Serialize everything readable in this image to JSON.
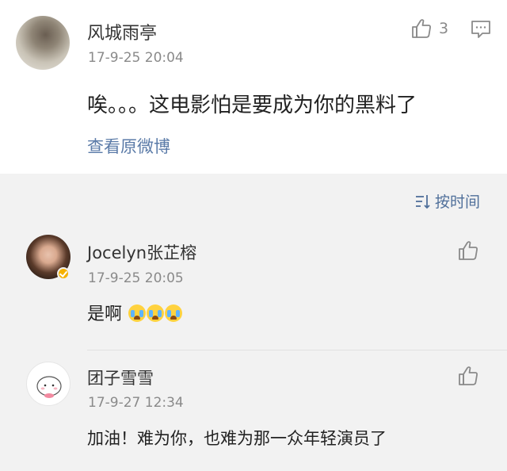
{
  "post": {
    "author": "风城雨亭",
    "time": "17-9-25 20:04",
    "text": "唉。。。这电影怕是要成为你的黑料了",
    "like_count": "3",
    "view_original": "查看原微博"
  },
  "sort": {
    "label": "按时间"
  },
  "comments": [
    {
      "author": "Jocelyn张芷榕",
      "time": "17-9-25 20:05",
      "text": "是啊",
      "emoji": [
        "泪",
        "泪",
        "泪"
      ],
      "verified": true
    },
    {
      "author": "团子雪雪",
      "time": "17-9-27 12:34",
      "text": "加油！难为你，也难为那一众年轻演员了"
    }
  ],
  "icons": {
    "like": "thumbs-up-icon",
    "comment": "comment-icon",
    "sort": "sort-icon",
    "verified": "verified-badge-icon",
    "emoji": "crying-face-emoji"
  },
  "colors": {
    "link": "#5b7ba8",
    "sort_text": "#4f6f9a",
    "meta": "#8a8a8a",
    "badge": "#f5b100"
  }
}
